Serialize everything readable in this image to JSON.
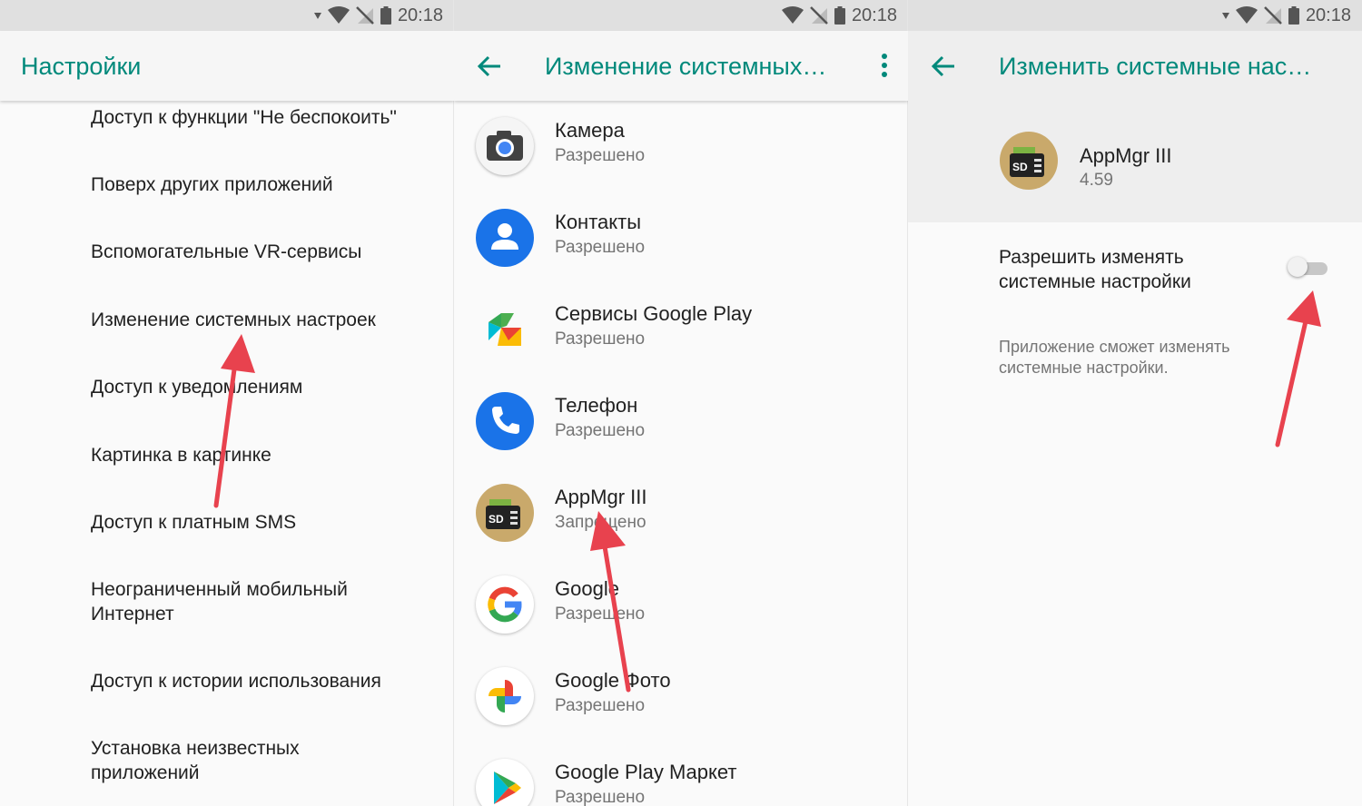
{
  "status_bar": {
    "time": "20:18"
  },
  "panel1": {
    "title": "Настройки",
    "items": [
      "Доступ к функции \"Не беспокоить\"",
      "Поверх других приложений",
      "Вспомогательные VR-сервисы",
      "Изменение системных настроек",
      "Доступ к уведомлениям",
      "Картинка в картинке",
      "Доступ к платным SMS",
      "Неограниченный мобильный",
      "Интернет",
      "Доступ к истории использования",
      "Установка неизвестных",
      "приложений"
    ]
  },
  "panel2": {
    "title": "Изменение системных…",
    "apps": [
      {
        "name": "Камера",
        "status": "Разрешено",
        "icon": "camera-icon"
      },
      {
        "name": "Контакты",
        "status": "Разрешено",
        "icon": "contacts-icon"
      },
      {
        "name": "Сервисы Google Play",
        "status": "Разрешено",
        "icon": "google-play-services-icon"
      },
      {
        "name": "Телефон",
        "status": "Разрешено",
        "icon": "phone-icon"
      },
      {
        "name": "AppMgr III",
        "status": "Запрещено",
        "icon": "appmgr-icon"
      },
      {
        "name": "Google",
        "status": "Разрешено",
        "icon": "google-icon"
      },
      {
        "name": "Google Фото",
        "status": "Разрешено",
        "icon": "google-photos-icon"
      },
      {
        "name": "Google Play Маркет",
        "status": "Разрешено",
        "icon": "play-store-icon"
      }
    ]
  },
  "panel3": {
    "title": "Изменить системные нас…",
    "app_name": "AppMgr III",
    "app_version": "4.59",
    "toggle_label_line1": "Разрешить изменять",
    "toggle_label_line2": "системные настройки",
    "toggle_on": false,
    "description_line1": "Приложение сможет изменять",
    "description_line2": "системные настройки."
  },
  "colors": {
    "accent": "#00897b",
    "arrow": "#e8424e"
  }
}
